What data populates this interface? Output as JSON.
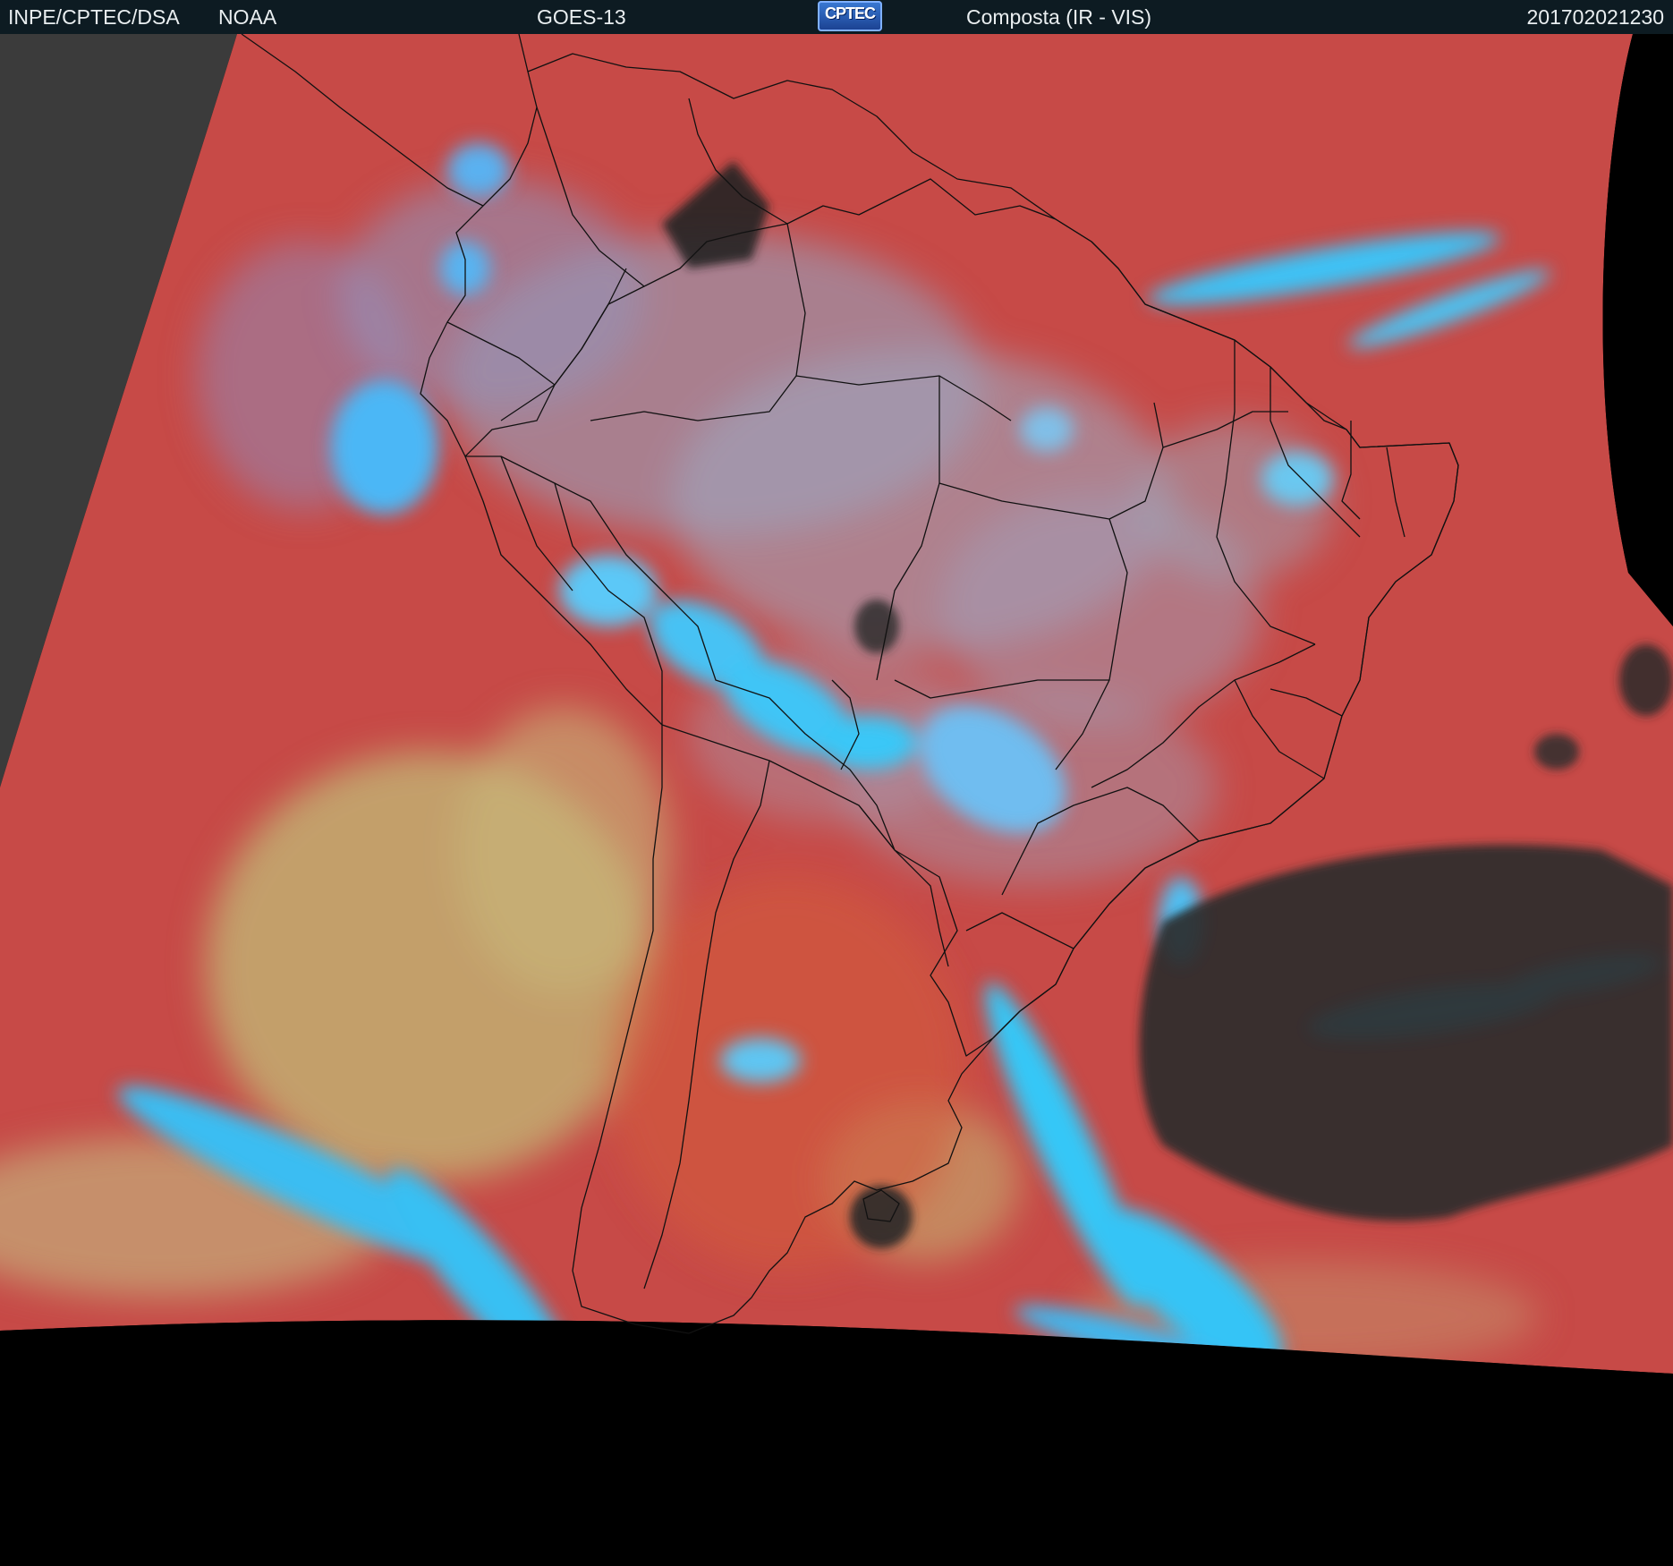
{
  "header": {
    "source": "INPE/CPTEC/DSA",
    "agency": "NOAA",
    "satellite": "GOES-13",
    "logo_text": "CPTEC",
    "product": "Composta (IR - VIS)",
    "timestamp": "201702021230"
  },
  "palette": {
    "background": "#000000",
    "header_bg": "#0d1b22",
    "ocean_clear": "#c94a45",
    "high_cloud": "#2fc6f5",
    "mid_cloud": "#8fa3c4",
    "low_cloud": "#c9ad6e",
    "ir_only": "#3a3a3a",
    "coastline": "#111111"
  }
}
